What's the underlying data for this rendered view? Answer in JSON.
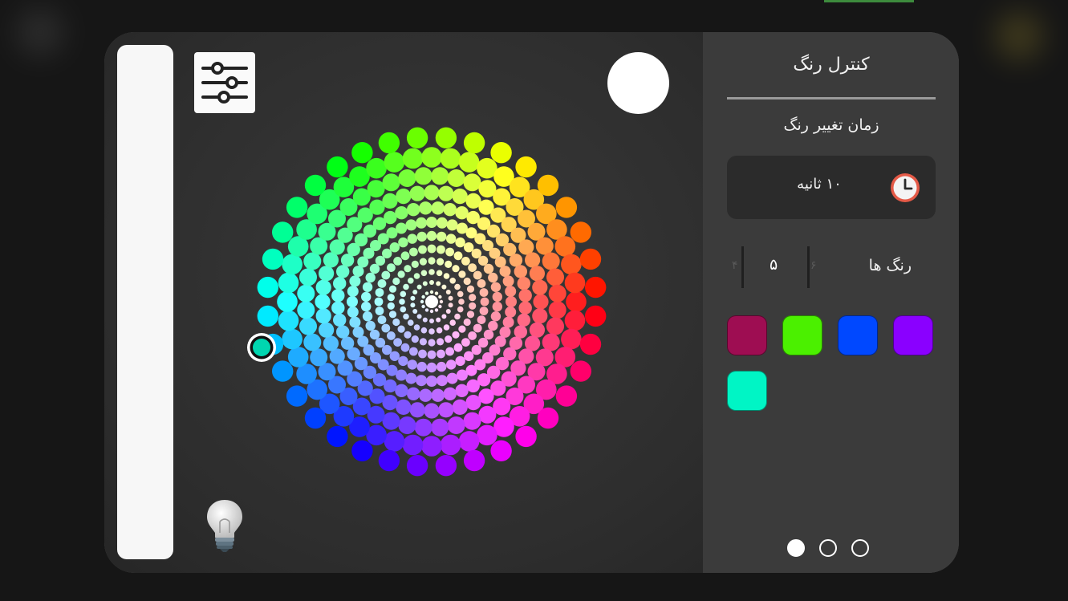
{
  "panel": {
    "title": "کنترل رنگ",
    "section_label": "زمان تغییر رنگ",
    "time_value": "۱۰ ثانیه",
    "colors_label": "رنگ ها",
    "count_picker": {
      "previous": "۴",
      "current": "۵",
      "next": "۶"
    },
    "swatches": [
      "#9e0d52",
      "#4bf000",
      "#0048ff",
      "#8a00ff",
      "#00f5c5"
    ],
    "pages": {
      "count": 3,
      "active_index": 0
    }
  },
  "wheel": {
    "selected_color": "#00d6b0",
    "preview_color": "#ffffff",
    "brightness_bar_color": "#f7f7f7"
  },
  "icons": {
    "settings": "sliders-icon",
    "clock": "clock-icon",
    "bulb": "lightbulb-icon"
  }
}
